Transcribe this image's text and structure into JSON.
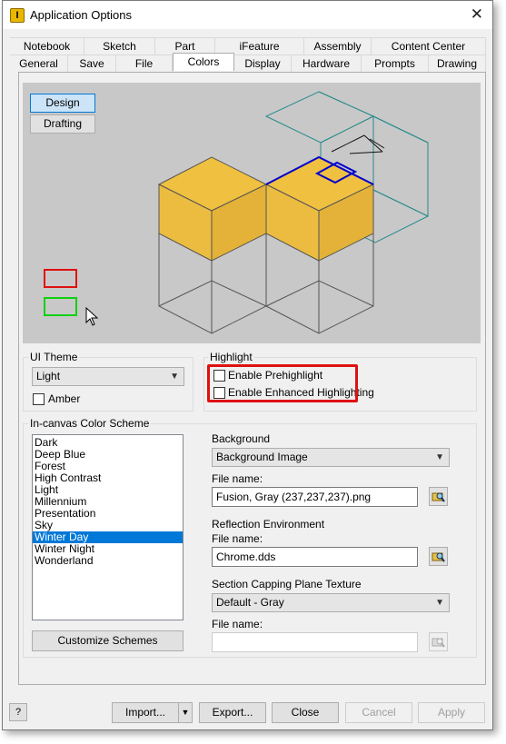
{
  "window": {
    "title": "Application Options",
    "close_glyph": "✕"
  },
  "tabs_row1": [
    "Notebook",
    "Sketch",
    "Part",
    "iFeature",
    "Assembly",
    "Content Center"
  ],
  "tabs_row2": [
    "General",
    "Save",
    "File",
    "Colors",
    "Display",
    "Hardware",
    "Prompts",
    "Drawing"
  ],
  "active_tab": "Colors",
  "preview": {
    "modes": [
      "Design",
      "Drafting"
    ],
    "selected_mode": "Design"
  },
  "ui_theme": {
    "group_label": "UI Theme",
    "value": "Light",
    "amber_label": "Amber",
    "amber_checked": false
  },
  "highlight": {
    "group_label": "Highlight",
    "prehighlight_label": "Enable Prehighlight",
    "enhanced_label": "Enable Enhanced Highlighting",
    "prehighlight_checked": false,
    "enhanced_checked": false
  },
  "color_scheme": {
    "group_label": "In-canvas Color Scheme",
    "items": [
      "Dark",
      "Deep Blue",
      "Forest",
      "High Contrast",
      "Light",
      "Millennium",
      "Presentation",
      "Sky",
      "Winter Day",
      "Winter Night",
      "Wonderland"
    ],
    "selected": "Winter Day",
    "customize_label": "Customize Schemes"
  },
  "background": {
    "label": "Background",
    "value": "Background Image",
    "file_label": "File name:",
    "file_value": "Fusion, Gray (237,237,237).png"
  },
  "reflection": {
    "label": "Reflection Environment",
    "file_label": "File name:",
    "file_value": "Chrome.dds"
  },
  "section_capping": {
    "label": "Section Capping Plane Texture",
    "value": "Default - Gray",
    "file_label": "File name:",
    "file_value": ""
  },
  "footer": {
    "help_glyph": "?",
    "import_label": "Import...",
    "export_label": "Export...",
    "close_label": "Close",
    "cancel_label": "Cancel",
    "apply_label": "Apply"
  },
  "colors": {
    "preview_bg": "#c8c8c8",
    "cube_face": "#f0c040",
    "wire": "#2a8a8a",
    "selection": "#0000cc",
    "annotation_red": "#e01010"
  }
}
